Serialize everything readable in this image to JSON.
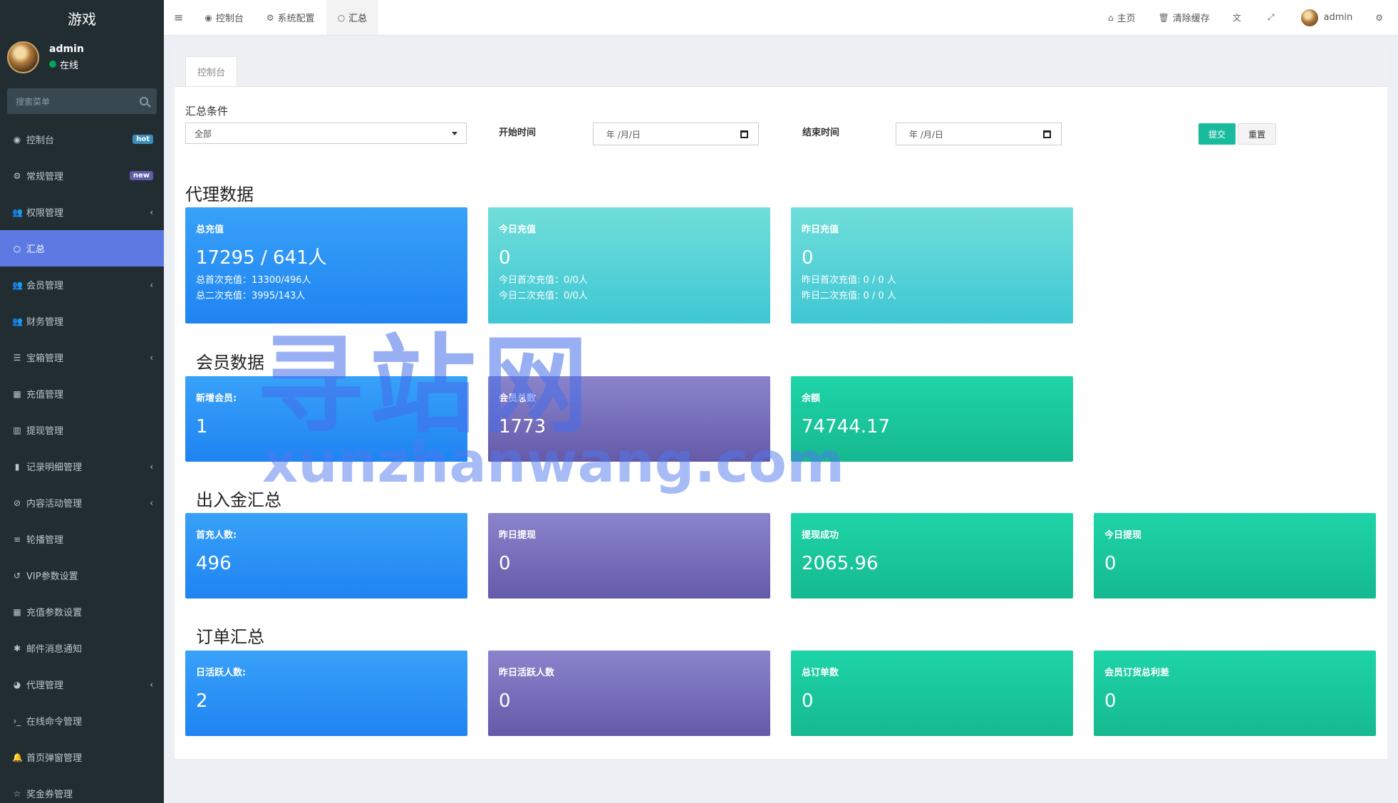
{
  "brand": "游戏",
  "user": {
    "name": "admin",
    "status": "在线"
  },
  "sidebar": {
    "search_placeholder": "搜索菜单",
    "items": [
      {
        "label": "控制台",
        "icon": "dashboard-icon",
        "glyph": "◉",
        "badge": "hot",
        "expand": false
      },
      {
        "label": "常规管理",
        "icon": "cogs-icon",
        "glyph": "⚙",
        "badge": "new",
        "expand": false
      },
      {
        "label": "权限管理",
        "icon": "group-icon",
        "glyph": "👥",
        "badge": "",
        "expand": true
      },
      {
        "label": "汇总",
        "icon": "circle-icon",
        "glyph": "○",
        "badge": "",
        "expand": false,
        "active": true
      },
      {
        "label": "会员管理",
        "icon": "users-icon",
        "glyph": "👥",
        "badge": "",
        "expand": true
      },
      {
        "label": "财务管理",
        "icon": "users-icon",
        "glyph": "👥",
        "badge": "",
        "expand": false
      },
      {
        "label": "宝箱管理",
        "icon": "list-icon",
        "glyph": "☰",
        "badge": "",
        "expand": true
      },
      {
        "label": "充值管理",
        "icon": "grid-icon",
        "glyph": "▦",
        "badge": "",
        "expand": false
      },
      {
        "label": "提现管理",
        "icon": "building-icon",
        "glyph": "▥",
        "badge": "",
        "expand": false
      },
      {
        "label": "记录明细管理",
        "icon": "bar-chart-icon",
        "glyph": "▮",
        "badge": "",
        "expand": true
      },
      {
        "label": "内容活动管理",
        "icon": "ban-icon",
        "glyph": "⊘",
        "badge": "",
        "expand": true
      },
      {
        "label": "轮播管理",
        "icon": "bars-icon",
        "glyph": "≡",
        "badge": "",
        "expand": false
      },
      {
        "label": "VIP参数设置",
        "icon": "history-icon",
        "glyph": "↺",
        "badge": "",
        "expand": false
      },
      {
        "label": "充值参数设置",
        "icon": "th-icon",
        "glyph": "▦",
        "badge": "",
        "expand": false
      },
      {
        "label": "邮件消息通知",
        "icon": "asterisk-icon",
        "glyph": "✱",
        "badge": "",
        "expand": false
      },
      {
        "label": "代理管理",
        "icon": "user-circle-icon",
        "glyph": "◕",
        "badge": "",
        "expand": true
      },
      {
        "label": "在线命令管理",
        "icon": "terminal-icon",
        "glyph": "›_",
        "badge": "",
        "expand": false
      },
      {
        "label": "首页弹窗管理",
        "icon": "bell-icon",
        "glyph": "🔔",
        "badge": "",
        "expand": false
      },
      {
        "label": "奖金券管理",
        "icon": "star-icon",
        "glyph": "☆",
        "badge": "",
        "expand": false
      }
    ]
  },
  "header": {
    "tabs": [
      {
        "label": "控制台",
        "icon": "dashboard-icon",
        "glyph": "◉"
      },
      {
        "label": "系统配置",
        "icon": "gear-icon",
        "glyph": "⚙"
      },
      {
        "label": "汇总",
        "icon": "circle-icon",
        "glyph": "○"
      }
    ],
    "home": "主页",
    "clear_cache": "清除缓存",
    "username": "admin"
  },
  "content": {
    "breadcrumb_tab": "控制台",
    "filter": {
      "label": "汇总条件",
      "select_value": "全部",
      "start_label": "开始时间",
      "end_label": "结束时间",
      "date_placeholder": "年 /月/日",
      "submit": "提交",
      "reset": "重置"
    },
    "sections": {
      "agent": "代理数据",
      "member": "会员数据",
      "flow": "出入金汇总",
      "order": "订单汇总"
    },
    "agent_cards": [
      {
        "title": "总充值",
        "value": "17295 / 641人",
        "sub1": "总首次充值：13300/496人",
        "sub2": "总二次充值：3995/143人"
      },
      {
        "title": "今日充值",
        "value": "0",
        "sub1": "今日首次充值：0/0人",
        "sub2": "今日二次充值：0/0人"
      },
      {
        "title": "昨日充值",
        "value": "0",
        "sub1": "昨日首次充值: 0 / 0 人",
        "sub2": "昨日二次充值: 0 / 0 人"
      }
    ],
    "member_cards": [
      {
        "title": "新增会员:",
        "value": "1"
      },
      {
        "title": "会员总数",
        "value": "1773"
      },
      {
        "title": "余额",
        "value": "74744.17"
      }
    ],
    "flow_cards": [
      {
        "title": "首充人数:",
        "value": "496"
      },
      {
        "title": "昨日提现",
        "value": "0"
      },
      {
        "title": "提现成功",
        "value": "2065.96"
      },
      {
        "title": "今日提现",
        "value": "0"
      }
    ],
    "order_cards": [
      {
        "title": "日活跃人数:",
        "value": "2"
      },
      {
        "title": "昨日活跃人数",
        "value": "0"
      },
      {
        "title": "总订单数",
        "value": "0"
      },
      {
        "title": "会员订货总利差",
        "value": "0"
      }
    ]
  },
  "watermark": {
    "cn": "寻站网",
    "en": "xunzhanwang.com"
  },
  "colors": {
    "sidebar": "#222d32",
    "active": "#5c7ae2",
    "submit": "#18bc9c",
    "blue": "#1f84f2",
    "purple": "#645aa9",
    "green": "#16b98f",
    "cyan": "#3fc7d4"
  }
}
